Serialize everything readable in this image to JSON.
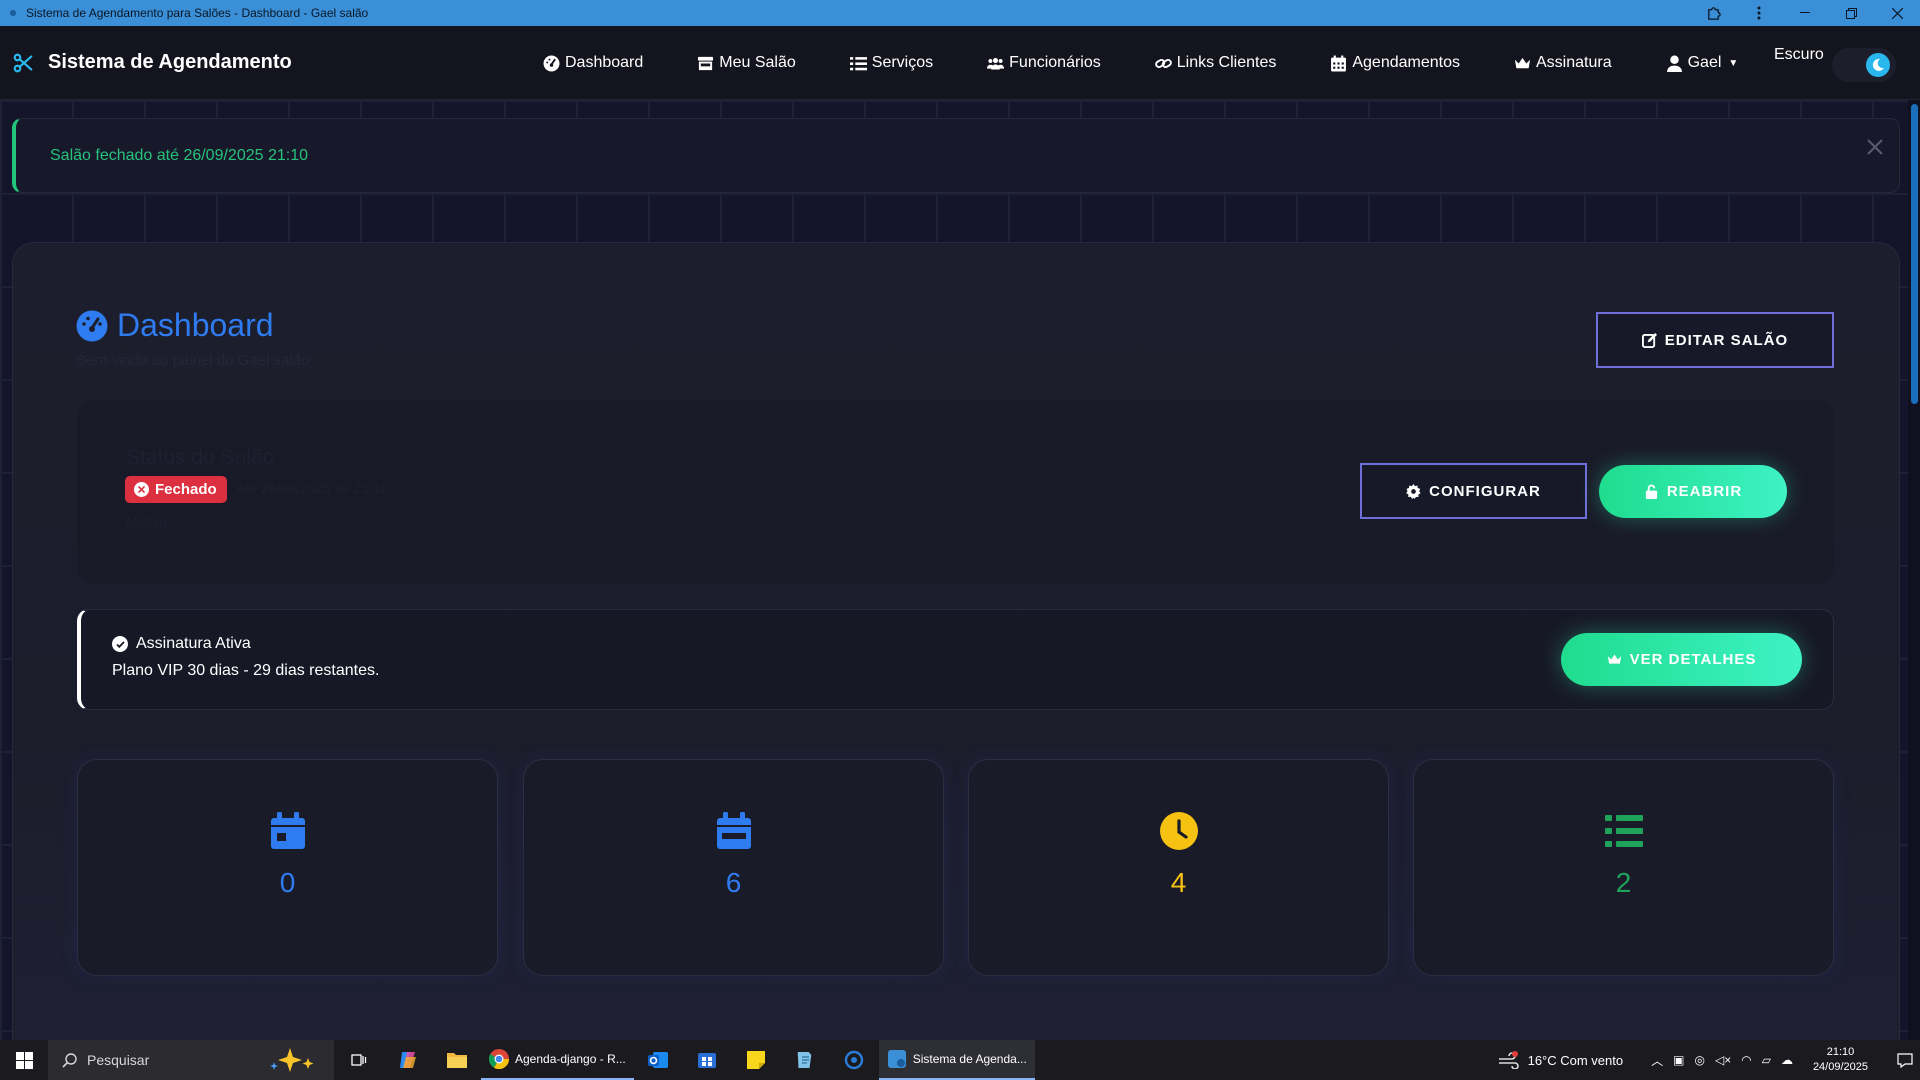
{
  "window": {
    "title": "Sistema de Agendamento para Salões - Dashboard - Gael salão"
  },
  "navbar": {
    "brand": "Sistema de Agendamento",
    "links": [
      {
        "label": "Dashboard",
        "icon": "gauge-icon"
      },
      {
        "label": "Meu Salão",
        "icon": "store-icon"
      },
      {
        "label": "Serviços",
        "icon": "list-icon"
      },
      {
        "label": "Funcionários",
        "icon": "users-icon"
      },
      {
        "label": "Links Clientes",
        "icon": "link-icon"
      },
      {
        "label": "Agendamentos",
        "icon": "calendar-icon"
      },
      {
        "label": "Assinatura",
        "icon": "crown-icon"
      }
    ],
    "user": "Gael",
    "theme_label": "Escuro"
  },
  "alert": {
    "message": "Salão fechado até 26/09/2025 21:10"
  },
  "dashboard": {
    "title": "Dashboard",
    "subtitle": "Bem-vindo ao painel do Gael salão",
    "edit_button": "EDITAR SALÃO"
  },
  "status": {
    "heading": "Status do Salão",
    "badge": "Fechado",
    "note": "Até 26/09/2025 às 21:10",
    "reason_label": "Motivo",
    "configure_button": "CONFIGURAR",
    "reopen_button": "REABRIR"
  },
  "subscription": {
    "title": "Assinatura Ativa",
    "description": "Plano VIP 30 dias - 29 dias restantes.",
    "details_button": "VER DETALHES"
  },
  "stats": [
    {
      "value": "0",
      "icon": "calendar-day-icon",
      "color": "#2f7bf0"
    },
    {
      "value": "6",
      "icon": "calendar-week-icon",
      "color": "#2f7bf0"
    },
    {
      "value": "4",
      "icon": "clock-icon",
      "color": "#f5c211"
    },
    {
      "value": "2",
      "icon": "list-icon",
      "color": "#1fa35a"
    }
  ],
  "taskbar": {
    "search_placeholder": "Pesquisar",
    "apps": [
      {
        "label": "Agenda-django - R..."
      },
      {
        "label": "Sistema de Agenda..."
      }
    ],
    "weather": "16°C  Com vento",
    "time": "21:10",
    "date": "24/09/2025"
  }
}
